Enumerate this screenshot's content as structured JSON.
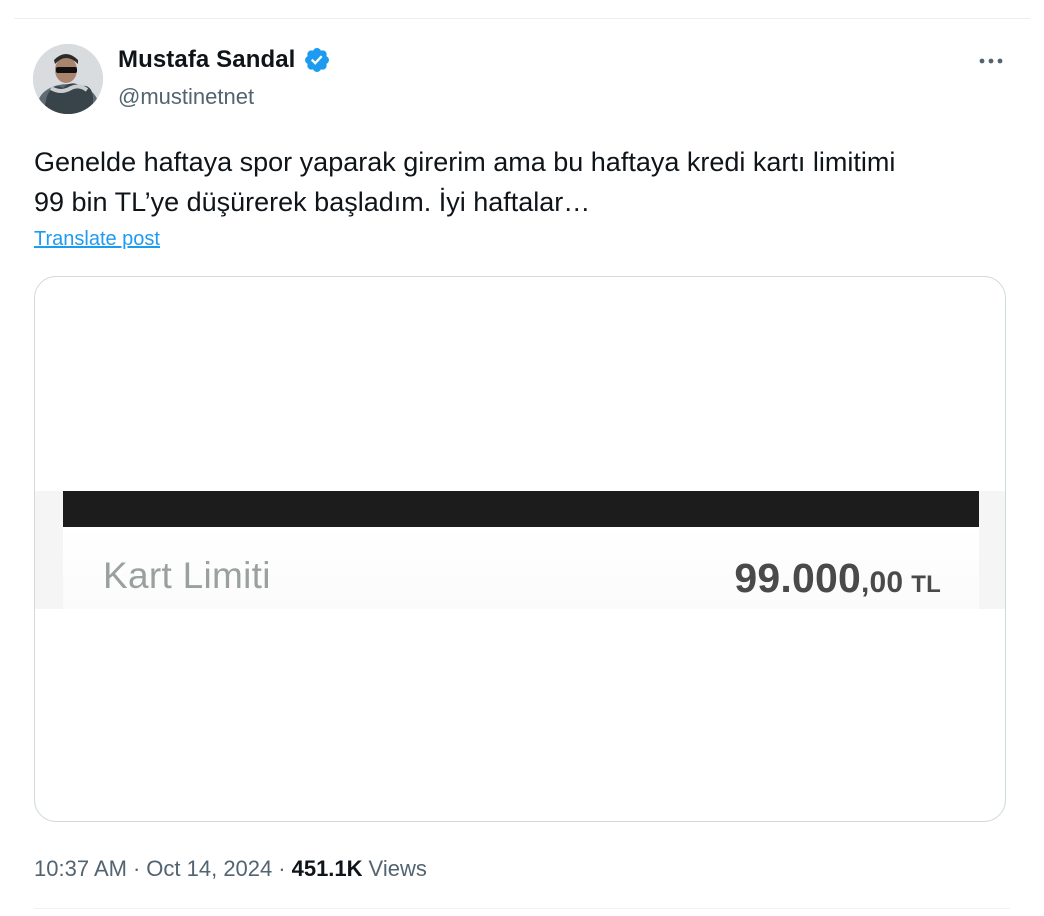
{
  "author": {
    "display_name": "Mustafa Sandal",
    "handle": "@mustinetnet",
    "verified": true,
    "avatar_icon": "profile-photo",
    "verified_icon": "verified-badge-icon",
    "badge_color": "#1d9bf0"
  },
  "tweet": {
    "text_line1": "Genelde haftaya spor yaparak girerim ama bu haftaya kredi kartı limitimi",
    "text_line2": "99 bin TL’ye düşürerek başladım. İyi haftalar…",
    "translate_label": "Translate post"
  },
  "media": {
    "limit_label": "Kart Limiti",
    "limit_value_main": "99.000",
    "limit_value_decimals": ",00",
    "limit_currency": "TL"
  },
  "meta": {
    "time": "10:37 AM",
    "separator": "·",
    "date": "Oct 14, 2024",
    "views_count": "451.1K",
    "views_label": "Views"
  },
  "colors": {
    "link": "#1d9bf0",
    "secondary_text": "#536471",
    "primary_text": "#0f1419"
  }
}
